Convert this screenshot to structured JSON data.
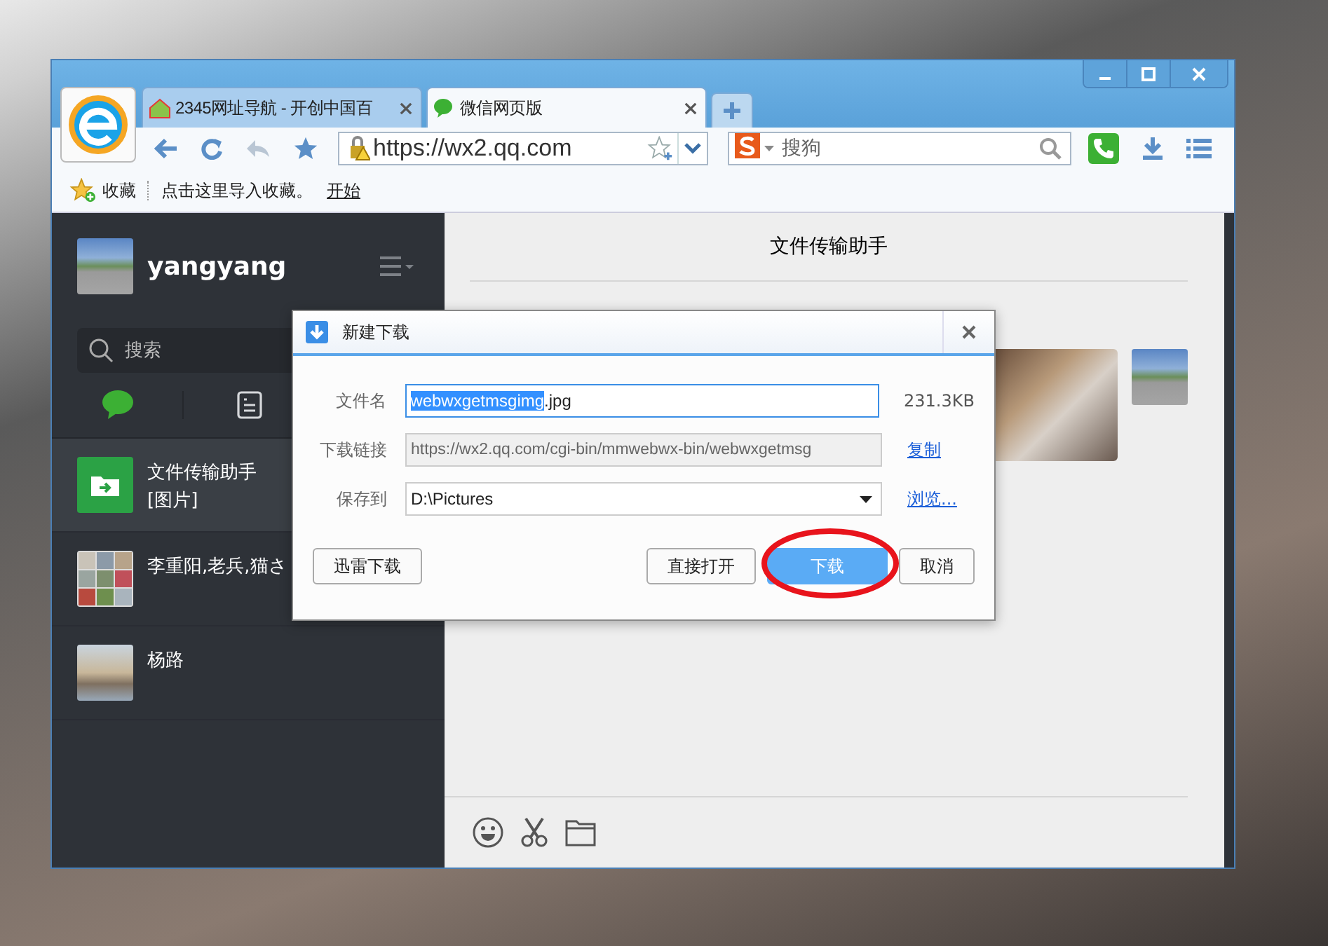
{
  "browser": {
    "tabs": [
      {
        "label": "2345网址导航 - 开创中国百",
        "selected": false
      },
      {
        "label": "微信网页版",
        "selected": true
      }
    ],
    "address": "https://wx2.qq.com",
    "search": {
      "placeholder": "搜狗"
    },
    "bookmarks_bar": {
      "favorites": "收藏",
      "import_hint": "点击这里导入收藏。",
      "start_link": "开始"
    }
  },
  "wechat": {
    "user": "yangyang",
    "search": {
      "placeholder": "搜索"
    },
    "sidebar_tabs": [
      {
        "selected": true
      },
      {
        "selected": false
      }
    ],
    "chats": [
      {
        "name": "文件传输助手",
        "preview": "[图片]",
        "selected": true,
        "kind": "file"
      },
      {
        "name": "李重阳,老兵,猫さ",
        "selected": false,
        "kind": "group"
      },
      {
        "name": "杨路",
        "selected": false,
        "kind": "person"
      }
    ],
    "chat_title": "文件传输助手"
  },
  "dialog": {
    "title": "新建下载",
    "file_name_label": "文件名",
    "file_name_stem": "webwxgetmsgimg",
    "stem_selected": true,
    "file_extension": ".jpg",
    "file_size": "231.3KB",
    "link_label": "下载链接",
    "link_value": "https://wx2.qq.com/cgi-bin/mmwebwx-bin/webwxgetmsg",
    "link_disabled": true,
    "copy_link": "复制",
    "save_label": "保存到",
    "save_value": "D:\\Pictures",
    "browse_link": "浏览...",
    "buttons": [
      {
        "label": "迅雷下载",
        "kind": "normal"
      },
      {
        "label": "直接打开",
        "kind": "normal"
      },
      {
        "label": "下载",
        "kind": "primary"
      },
      {
        "label": "取消",
        "kind": "normal"
      }
    ]
  }
}
